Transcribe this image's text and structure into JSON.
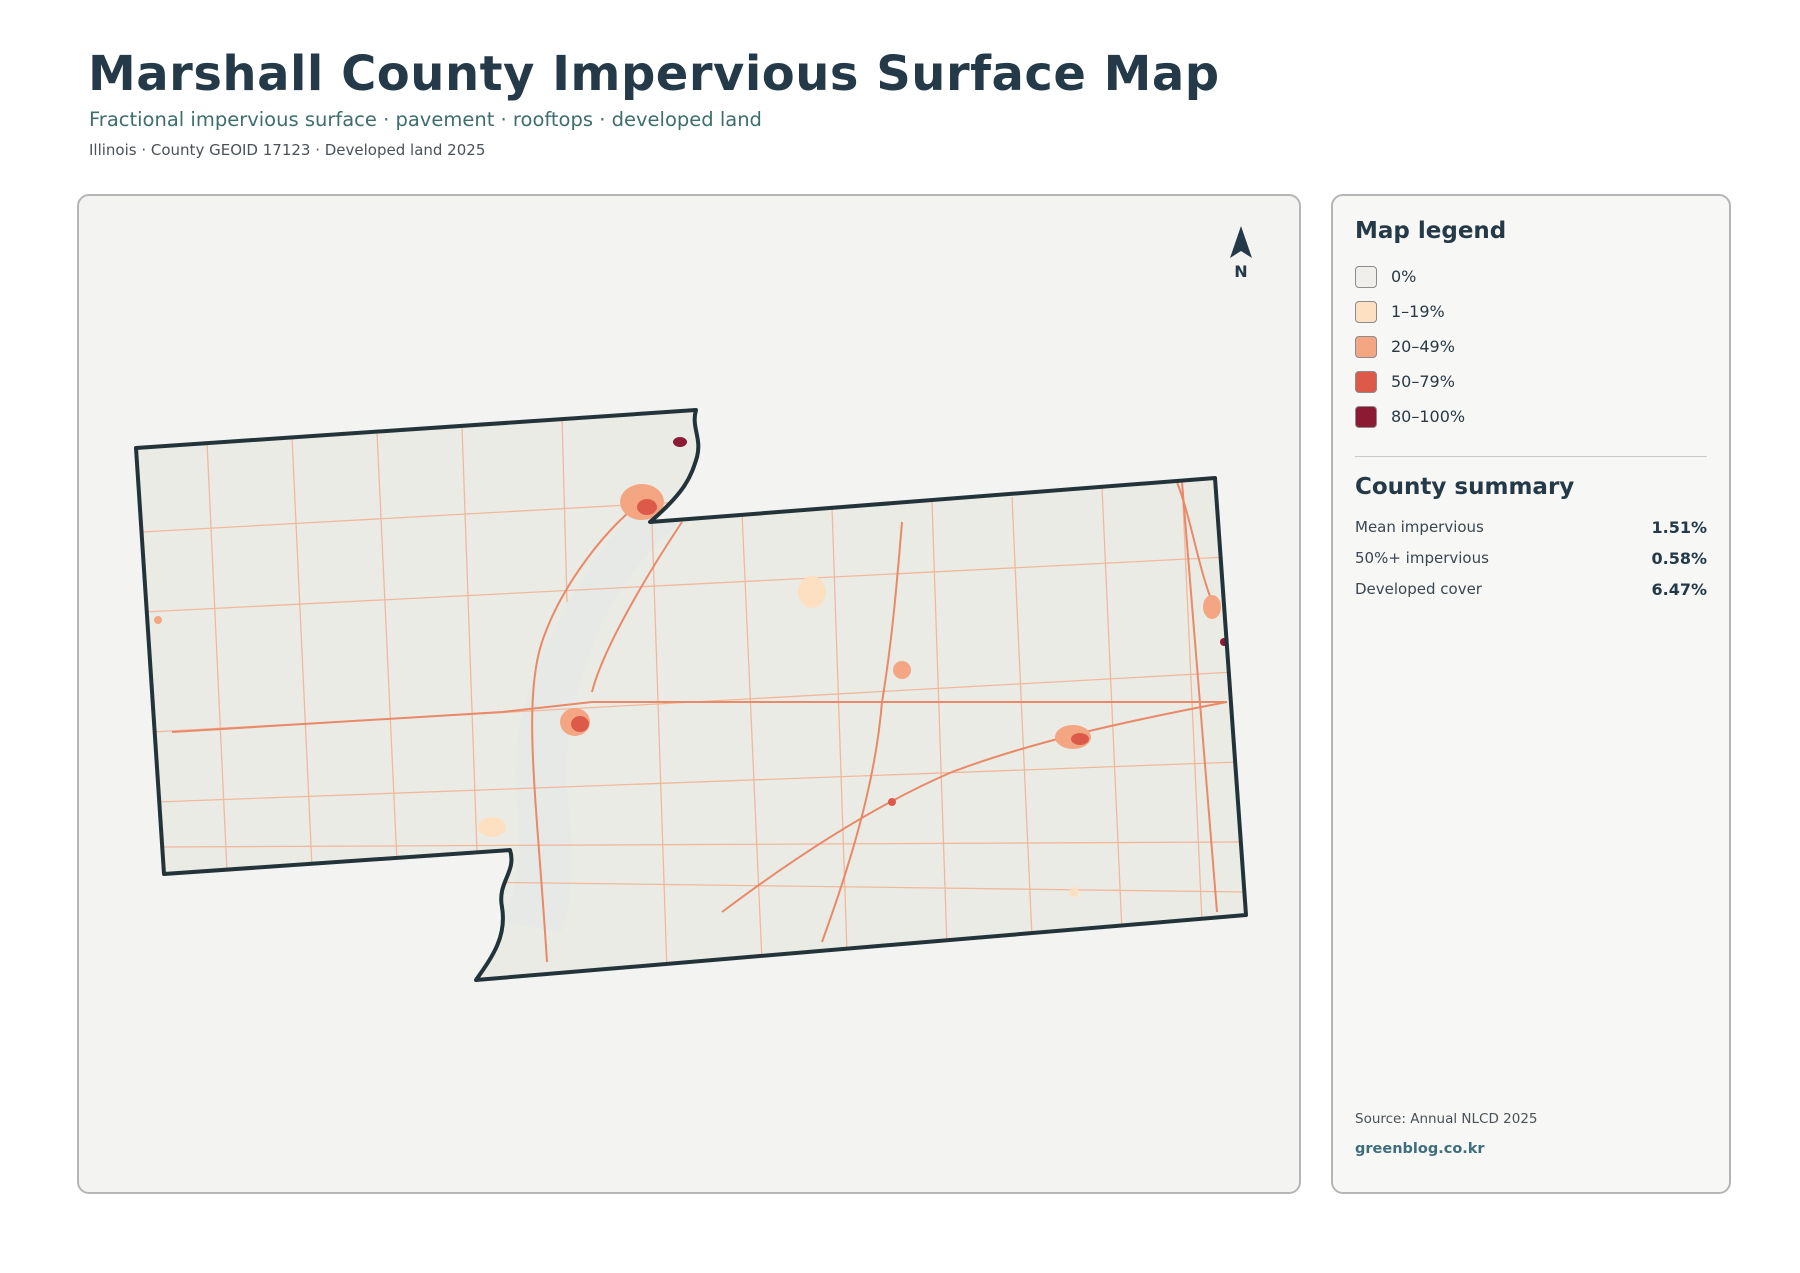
{
  "header": {
    "title": "Marshall County Impervious Surface Map",
    "subtitle": "Fractional impervious surface · pavement · rooftops · developed land",
    "meta": "Illinois · County GEOID 17123 · Developed land 2025"
  },
  "map": {
    "north_label": "N"
  },
  "legend": {
    "title": "Map legend",
    "items": [
      {
        "label": "0%",
        "color": "#f0efeb"
      },
      {
        "label": "1–19%",
        "color": "#fde0c2"
      },
      {
        "label": "20–49%",
        "color": "#f4a582"
      },
      {
        "label": "50–79%",
        "color": "#dd5a4b"
      },
      {
        "label": "80–100%",
        "color": "#8c1a33"
      }
    ]
  },
  "summary": {
    "title": "County summary",
    "stats": [
      {
        "label": "Mean impervious",
        "value": "1.51%"
      },
      {
        "label": "50%+ impervious",
        "value": "0.58%"
      },
      {
        "label": "Developed cover",
        "value": "6.47%"
      }
    ]
  },
  "footer": {
    "source": "Source: Annual NLCD 2025",
    "credit": "greenblog.co.kr"
  }
}
